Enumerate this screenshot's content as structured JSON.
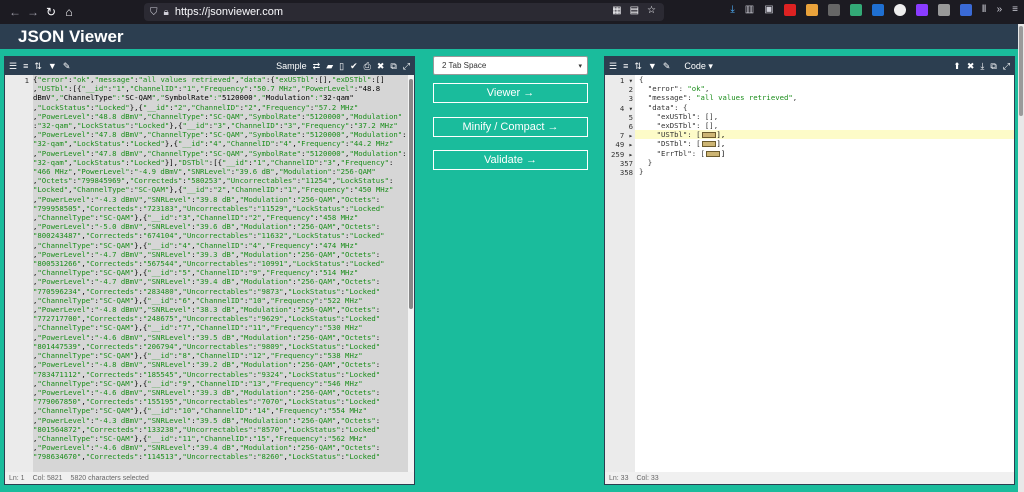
{
  "browser": {
    "url": "https://jsonviewer.com"
  },
  "app": {
    "title": "JSON Viewer"
  },
  "left_panel": {
    "sample_label": "Sample",
    "status_ln": "Ln: 1",
    "status_col": "Col: 5821",
    "status_sel": "5820 characters selected",
    "line_number": "1"
  },
  "middle": {
    "select_value": "2 Tab Space",
    "viewer_btn": "Viewer →",
    "minify_btn": "Minify / Compact →",
    "validate_btn": "Validate →"
  },
  "right_panel": {
    "code_label": "Code ▾",
    "status_ln": "Ln: 33",
    "status_col": "Col: 33",
    "line_numbers": [
      "1",
      "2",
      "3",
      "4",
      "5",
      "6",
      "7",
      "49",
      "259",
      "357",
      "358"
    ],
    "lines": [
      "{",
      "  \"error\": \"ok\",",
      "  \"message\": \"all values retrieved\",",
      "  \"data\": {",
      "    \"exUSTbl\": [],",
      "    \"exDSTbl\": [],",
      "    \"USTbl\": [",
      "    \"DSTbl\": [",
      "    \"ErrTbl\": [",
      "  }",
      "}"
    ]
  },
  "raw_lines": [
    "{\"error\":\"ok\",\"message\":\"all values retrieved\",\"data\":{\"exUSTbl\":[],\"exDSTbl\":[]",
    ",\"USTbl\":[{\"__id\":\"1\",\"ChannelID\":\"1\",\"Frequency\":\"50.7 MHz\",\"PowerLevel\":\"48.8",
    "dBmV\",\"ChannelType\":\"SC-QAM\",\"SymbolRate\":\"5120000\",\"Modulation\":\"32-qam\"",
    ",\"LockStatus\":\"Locked\"},{\"__id\":\"2\",\"ChannelID\":\"2\",\"Frequency\":\"57.2 MHz\"",
    ",\"PowerLevel\":\"48.8 dBmV\",\"ChannelType\":\"SC-QAM\",\"SymbolRate\":\"5120000\",\"Modulation\"",
    ":\"32-qam\",\"LockStatus\":\"Locked\"},{\"__id\":\"3\",\"ChannelID\":\"3\",\"Frequency\":\"37.2 MHz\"",
    ",\"PowerLevel\":\"47.8 dBmV\",\"ChannelType\":\"SC-QAM\",\"SymbolRate\":\"5120000\",\"Modulation\":",
    "\"32-qam\",\"LockStatus\":\"Locked\"},{\"__id\":\"4\",\"ChannelID\":\"4\",\"Frequency\":\"44.2 MHz\"",
    ",\"PowerLevel\":\"47.8 dBmV\",\"ChannelType\":\"SC-QAM\",\"SymbolRate\":\"5120000\",\"Modulation\":",
    "\"32-qam\",\"LockStatus\":\"Locked\"}],\"DSTbl\":[{\"__id\":\"1\",\"ChannelID\":\"3\",\"Frequency\":",
    "\"466 MHz\",\"PowerLevel\":\"-4.9 dBmV\",\"SNRLevel\":\"39.6 dB\",\"Modulation\":\"256-QAM\"",
    ",\"Octets\":\"799845969\",\"Correcteds\":\"580253\",\"Uncorrectables\":\"11254\",\"LockStatus\":",
    "\"Locked\",\"ChannelType\":\"SC-QAM\"},{\"__id\":\"2\",\"ChannelID\":\"1\",\"Frequency\":\"450 MHz\"",
    ",\"PowerLevel\":\"-4.3 dBmV\",\"SNRLevel\":\"39.8 dB\",\"Modulation\":\"256-QAM\",\"Octets\":",
    "\"799958505\",\"Correcteds\":\"723183\",\"Uncorrectables\":\"11529\",\"LockStatus\":\"Locked\"",
    ",\"ChannelType\":\"SC-QAM\"},{\"__id\":\"3\",\"ChannelID\":\"2\",\"Frequency\":\"458 MHz\"",
    ",\"PowerLevel\":\"-5.0 dBmV\",\"SNRLevel\":\"39.6 dB\",\"Modulation\":\"256-QAM\",\"Octets\":",
    "\"800243487\",\"Correcteds\":\"674104\",\"Uncorrectables\":\"11632\",\"LockStatus\":\"Locked\"",
    ",\"ChannelType\":\"SC-QAM\"},{\"__id\":\"4\",\"ChannelID\":\"4\",\"Frequency\":\"474 MHz\"",
    ",\"PowerLevel\":\"-4.7 dBmV\",\"SNRLevel\":\"39.3 dB\",\"Modulation\":\"256-QAM\",\"Octets\":",
    "\"800531266\",\"Correcteds\":\"567544\",\"Uncorrectables\":\"10991\",\"LockStatus\":\"Locked\"",
    ",\"ChannelType\":\"SC-QAM\"},{\"__id\":\"5\",\"ChannelID\":\"9\",\"Frequency\":\"514 MHz\"",
    ",\"PowerLevel\":\"-4.7 dBmV\",\"SNRLevel\":\"39.4 dB\",\"Modulation\":\"256-QAM\",\"Octets\":",
    "\"770596234\",\"Correcteds\":\"283480\",\"Uncorrectables\":\"9873\",\"LockStatus\":\"Locked\"",
    ",\"ChannelType\":\"SC-QAM\"},{\"__id\":\"6\",\"ChannelID\":\"10\",\"Frequency\":\"522 MHz\"",
    ",\"PowerLevel\":\"-4.8 dBmV\",\"SNRLevel\":\"38.3 dB\",\"Modulation\":\"256-QAM\",\"Octets\":",
    "\"772717700\",\"Correcteds\":\"248675\",\"Uncorrectables\":\"9629\",\"LockStatus\":\"Locked\"",
    ",\"ChannelType\":\"SC-QAM\"},{\"__id\":\"7\",\"ChannelID\":\"11\",\"Frequency\":\"530 MHz\"",
    ",\"PowerLevel\":\"-4.6 dBmV\",\"SNRLevel\":\"39.5 dB\",\"Modulation\":\"256-QAM\",\"Octets\":",
    "\"801447539\",\"Correcteds\":\"206794\",\"Uncorrectables\":\"9809\",\"LockStatus\":\"Locked\"",
    ",\"ChannelType\":\"SC-QAM\"},{\"__id\":\"8\",\"ChannelID\":\"12\",\"Frequency\":\"538 MHz\"",
    ",\"PowerLevel\":\"-4.8 dBmV\",\"SNRLevel\":\"39.2 dB\",\"Modulation\":\"256-QAM\",\"Octets\":",
    "\"783471112\",\"Correcteds\":\"185545\",\"Uncorrectables\":\"9324\",\"LockStatus\":\"Locked\"",
    ",\"ChannelType\":\"SC-QAM\"},{\"__id\":\"9\",\"ChannelID\":\"13\",\"Frequency\":\"546 MHz\"",
    ",\"PowerLevel\":\"-4.6 dBmV\",\"SNRLevel\":\"39.3 dB\",\"Modulation\":\"256-QAM\",\"Octets\":",
    "\"779067850\",\"Correcteds\":\"155195\",\"Uncorrectables\":\"7070\",\"LockStatus\":\"Locked\"",
    ",\"ChannelType\":\"SC-QAM\"},{\"__id\":\"10\",\"ChannelID\":\"14\",\"Frequency\":\"554 MHz\"",
    ",\"PowerLevel\":\"-4.3 dBmV\",\"SNRLevel\":\"39.5 dB\",\"Modulation\":\"256-QAM\",\"Octets\":",
    "\"801564872\",\"Correcteds\":\"133238\",\"Uncorrectables\":\"8570\",\"LockStatus\":\"Locked\"",
    ",\"ChannelType\":\"SC-QAM\"},{\"__id\":\"11\",\"ChannelID\":\"15\",\"Frequency\":\"562 MHz\"",
    ",\"PowerLevel\":\"-4.6 dBmV\",\"SNRLevel\":\"39.4 dB\",\"Modulation\":\"256-QAM\",\"Octets\":",
    "\"798634670\",\"Correcteds\":\"114513\",\"Uncorrectables\":\"8260\",\"LockStatus\":\"Locked\""
  ]
}
